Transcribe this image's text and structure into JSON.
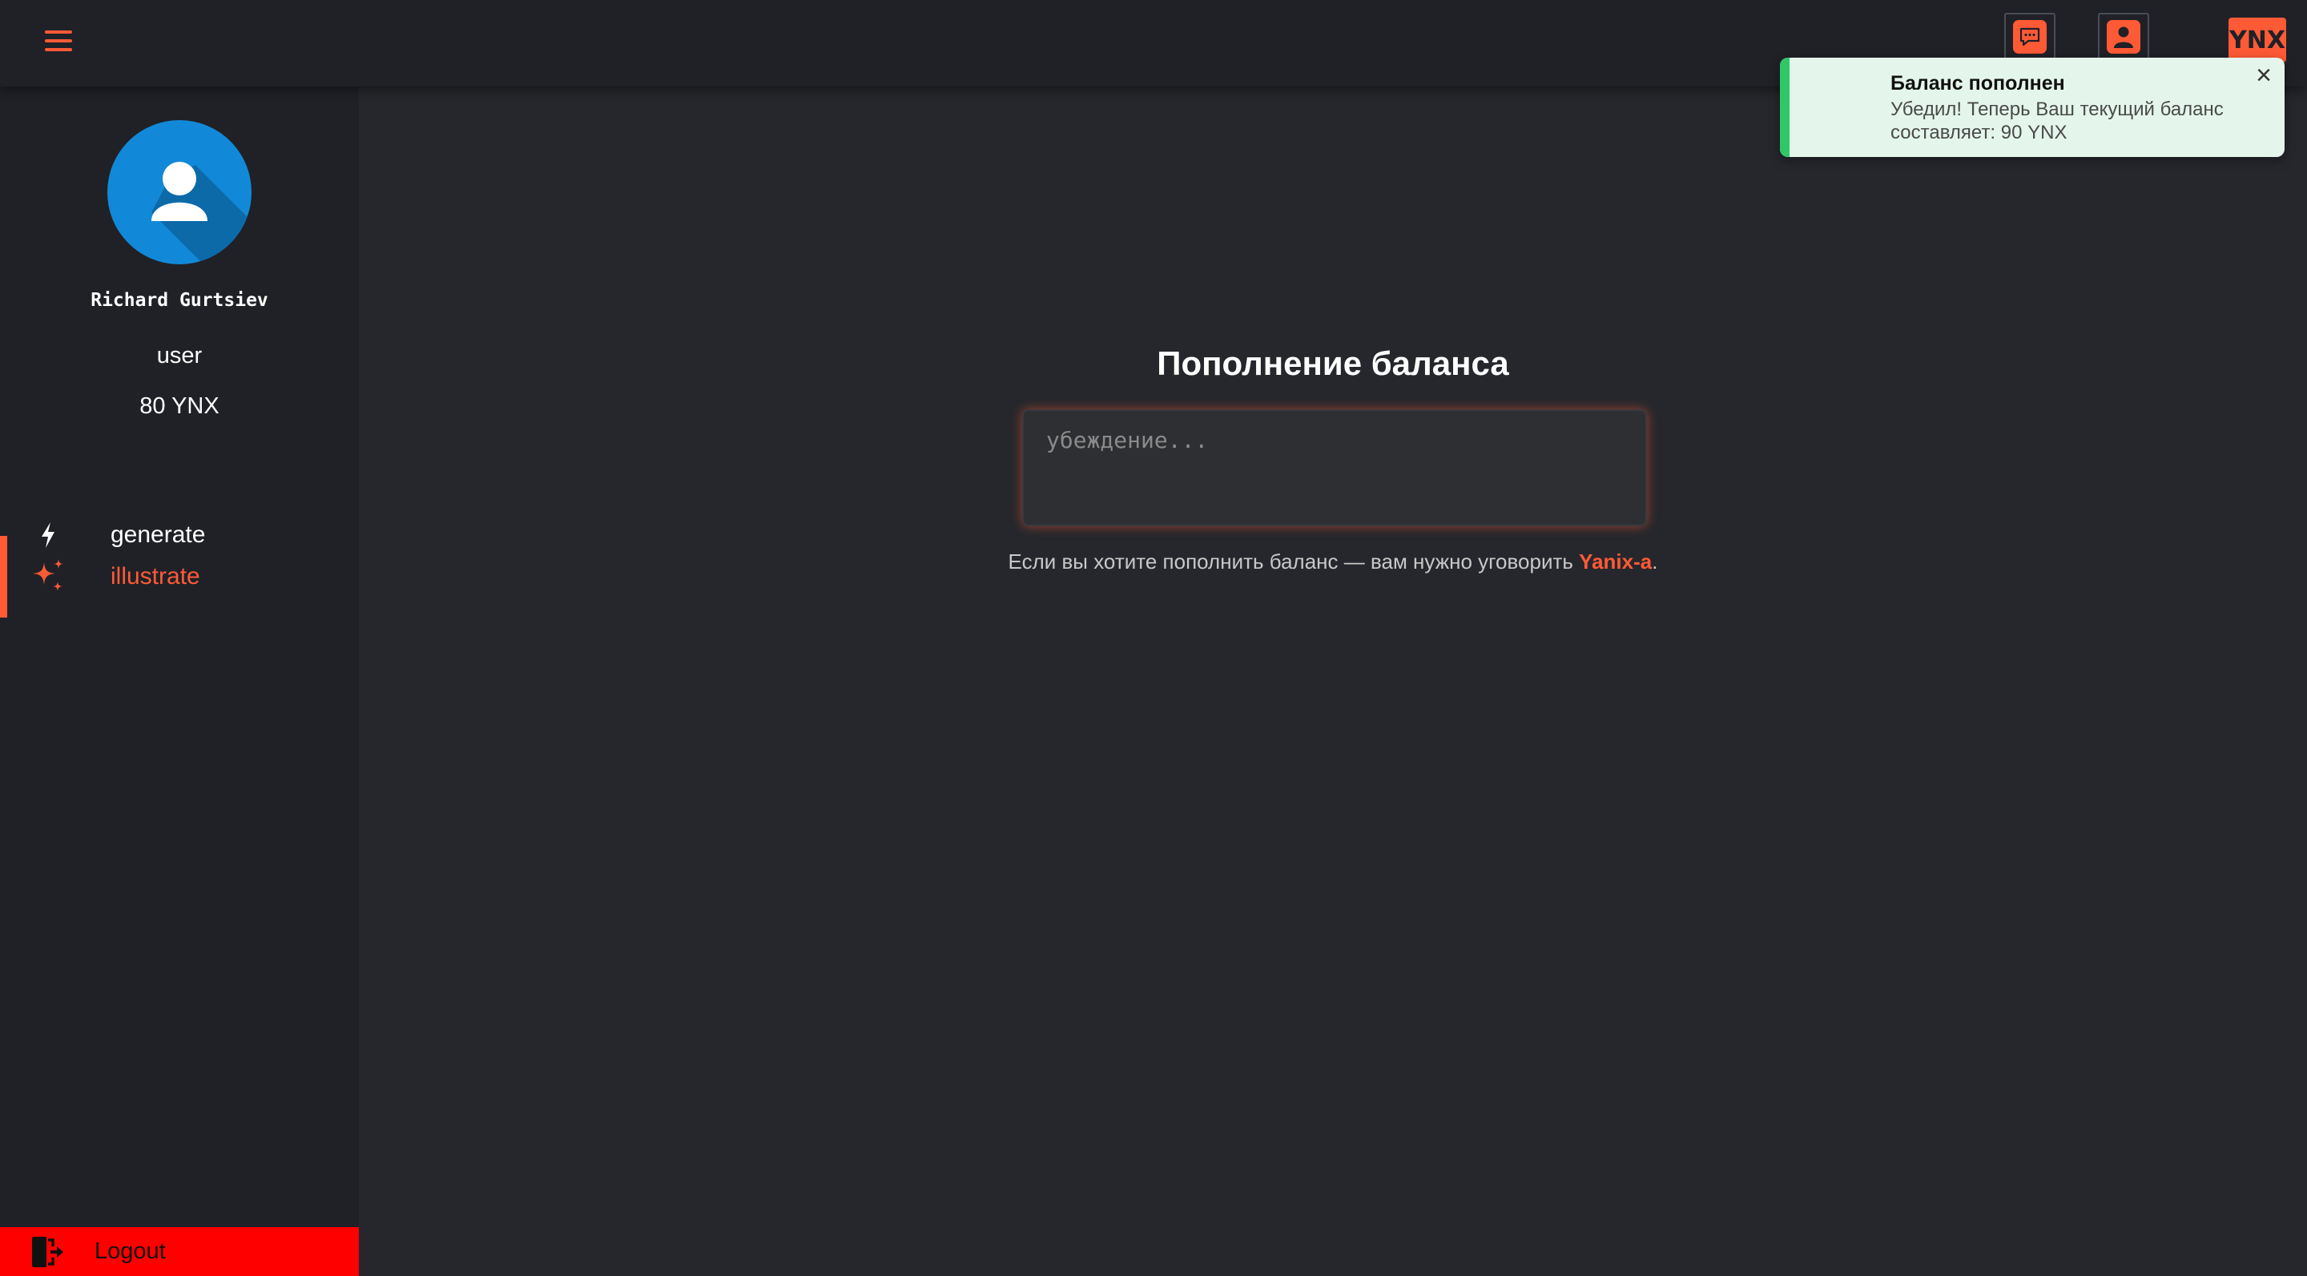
{
  "topbar": {
    "menu_icon": "hamburger-menu-icon",
    "chat_icon": "chat-bubble-icon",
    "profile_icon": "user-icon",
    "currency_badge": "YNX"
  },
  "sidebar": {
    "user": {
      "name": "Richard Gurtsiev",
      "role": "user",
      "balance": "80 YNX"
    },
    "items": [
      {
        "label": "generate",
        "icon": "lightning-icon",
        "active": false
      },
      {
        "label": "illustrate",
        "icon": "sparkles-icon",
        "active": true
      }
    ],
    "logout": {
      "label": "Logout",
      "icon": "logout-door-icon"
    }
  },
  "main": {
    "title": "Пополнение баланса",
    "persuasion": {
      "placeholder": "убеждение...",
      "value": ""
    },
    "hint": {
      "before": "Если вы хотите пополнить баланс — вам нужно уговорить ",
      "link": "Yanix-a",
      "after": "."
    }
  },
  "toast": {
    "title": "Баланс пополнен",
    "message": "Убедил! Теперь Ваш текущий баланс составляет: 90 YNX",
    "close_icon": "close-icon"
  },
  "colors": {
    "accent": "#ff5a36",
    "background": "#25272c",
    "sidebar": "#1f2127",
    "logout": "#ff0000",
    "success": "#2fc768",
    "avatar": "#1289d8"
  }
}
